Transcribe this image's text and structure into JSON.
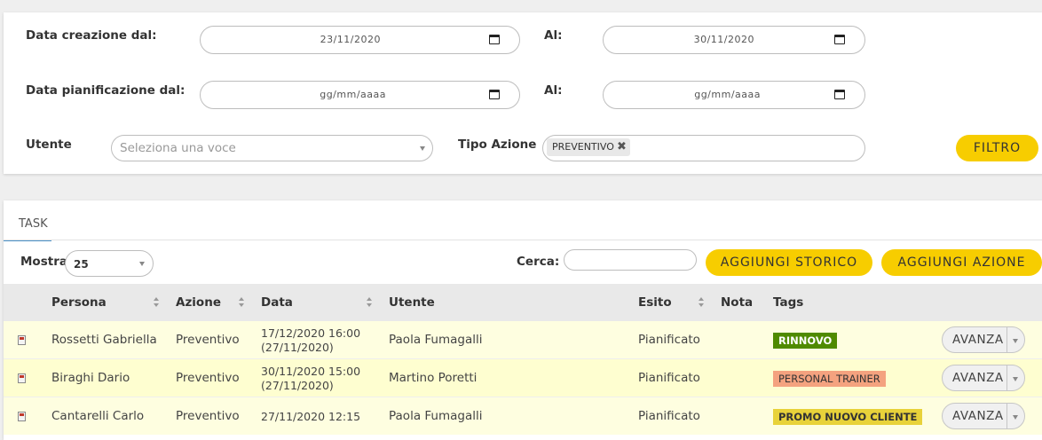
{
  "filters": {
    "creation_from_label": "Data creazione dal:",
    "creation_from_value": "23/11/2020",
    "creation_to_label": "Al:",
    "creation_to_value": "30/11/2020",
    "planning_from_label": "Data pianificazione dal:",
    "planning_from_value": "gg/mm/aaaa",
    "planning_to_label": "Al:",
    "planning_to_value": "gg/mm/aaaa",
    "user_label": "Utente",
    "user_placeholder": "Seleziona una voce",
    "action_type_label": "Tipo Azione",
    "action_type_chip": "PREVENTIVO",
    "chip_remove": "✖",
    "filter_button": "FILTRO"
  },
  "tasks": {
    "tab": "TASK",
    "show_label": "Mostra",
    "show_value": "25",
    "search_label": "Cerca:",
    "add_history_button": "AGGIUNGI STORICO",
    "add_action_button": "AGGIUNGI AZIONE",
    "columns": [
      "Persona",
      "Azione",
      "Data",
      "Utente",
      "Esito",
      "Nota",
      "Tags"
    ],
    "rows": [
      {
        "persona": "Rossetti Gabriella",
        "azione": "Preventivo",
        "data_1": "17/12/2020 16:00",
        "data_2": "(27/11/2020)",
        "utente": "Paola Fumagalli",
        "esito": "Pianificato",
        "nota": "",
        "tag": "RINNOVO",
        "action": "AVANZA"
      },
      {
        "persona": "Biraghi Dario",
        "azione": "Preventivo",
        "data_1": "30/11/2020 15:00",
        "data_2": "(27/11/2020)",
        "utente": "Martino Poretti",
        "esito": "Pianificato",
        "nota": "",
        "tag": "PERSONAL TRAINER",
        "action": "AVANZA"
      },
      {
        "persona": "Cantarelli Carlo",
        "azione": "Preventivo",
        "data_1": "27/11/2020 12:15",
        "data_2": "",
        "utente": "Paola Fumagalli",
        "esito": "Pianificato",
        "nota": "",
        "tag": "PROMO NUOVO CLIENTE",
        "action": "AVANZA"
      }
    ]
  },
  "colors": {
    "accent_yellow": "#f7cd00",
    "row_highlight": "#fefee0",
    "tag_rinnovo": "#4f8a00",
    "tag_personal_trainer": "#f4a27f",
    "tag_promo": "#e8d23a"
  },
  "icons": [
    "calendar-icon",
    "caret-down-icon",
    "remove-chip-icon",
    "sort-icon",
    "document-icon",
    "dropdown-caret-icon"
  ]
}
